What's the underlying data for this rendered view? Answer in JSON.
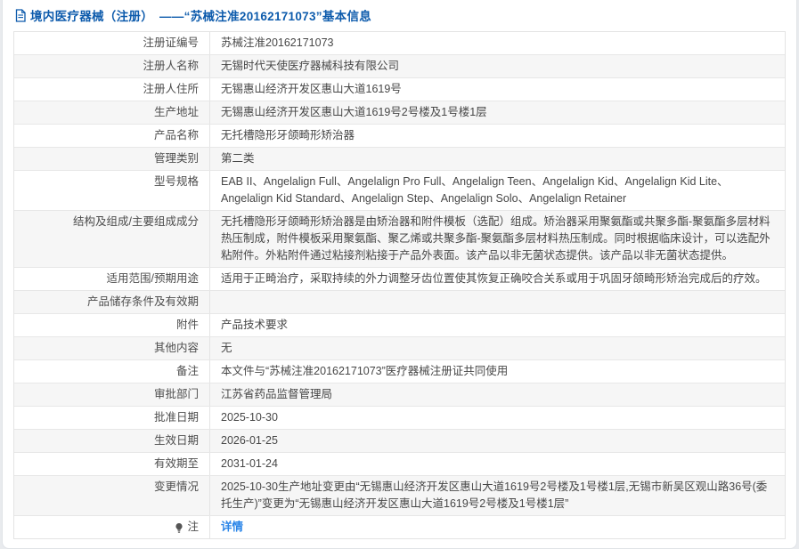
{
  "header": {
    "title": "境内医疗器械（注册）　——“苏械注准20162171073”基本信息",
    "icon": "document-icon"
  },
  "colors": {
    "title_blue": "#0d5bac",
    "link_blue": "#2a85e8",
    "row_alt_gray": "#f6f6f6",
    "border_gray": "#e4e4e4",
    "page_background": "#e9ebee",
    "text_gray": "#4a4a4a"
  },
  "table": {
    "rows": [
      {
        "label": "注册证编号",
        "value": "苏械注准20162171073"
      },
      {
        "label": "注册人名称",
        "value": "无锡时代天使医疗器械科技有限公司"
      },
      {
        "label": "注册人住所",
        "value": "无锡惠山经济开发区惠山大道1619号"
      },
      {
        "label": "生产地址",
        "value": "无锡惠山经济开发区惠山大道1619号2号楼及1号楼1层"
      },
      {
        "label": "产品名称",
        "value": "无托槽隐形牙颌畸形矫治器"
      },
      {
        "label": "管理类别",
        "value": "第二类"
      },
      {
        "label": "型号规格",
        "value": "EAB II、Angelalign Full、Angelalign Pro Full、Angelalign Teen、Angelalign Kid、Angelalign Kid Lite、Angelalign Kid Standard、Angelalign Step、Angelalign Solo、Angelalign Retainer"
      },
      {
        "label": "结构及组成/主要组成成分",
        "value": "无托槽隐形牙颌畸形矫治器是由矫治器和附件模板（选配）组成。矫治器采用聚氨酯或共聚多酯-聚氨酯多层材料热压制成，附件模板采用聚氨酯、聚乙烯或共聚多酯-聚氨酯多层材料热压制成。同时根据临床设计，可以选配外粘附件。外粘附件通过粘接剂粘接于产品外表面。该产品以非无菌状态提供。该产品以非无菌状态提供。"
      },
      {
        "label": "适用范围/预期用途",
        "value": "适用于正畸治疗，采取持续的外力调整牙齿位置使其恢复正确咬合关系或用于巩固牙颌畸形矫治完成后的疗效。"
      },
      {
        "label": "产品储存条件及有效期",
        "value": ""
      },
      {
        "label": "附件",
        "value": "产品技术要求"
      },
      {
        "label": "其他内容",
        "value": "无"
      },
      {
        "label": "备注",
        "value": "本文件与“苏械注准20162171073”医疗器械注册证共同使用"
      },
      {
        "label": "审批部门",
        "value": "江苏省药品监督管理局"
      },
      {
        "label": "批准日期",
        "value": "2025-10-30"
      },
      {
        "label": "生效日期",
        "value": "2026-01-25"
      },
      {
        "label": "有效期至",
        "value": "2031-01-24"
      },
      {
        "label": "变更情况",
        "value": "2025-10-30生产地址变更由“无锡惠山经济开发区惠山大道1619号2号楼及1号楼1层,无锡市新吴区观山路36号(委托生产)”变更为“无锡惠山经济开发区惠山大道1619号2号楼及1号楼1层”"
      },
      {
        "label": "注",
        "value": "详情",
        "label_icon": "lightbulb-icon",
        "value_type": "link"
      }
    ]
  }
}
